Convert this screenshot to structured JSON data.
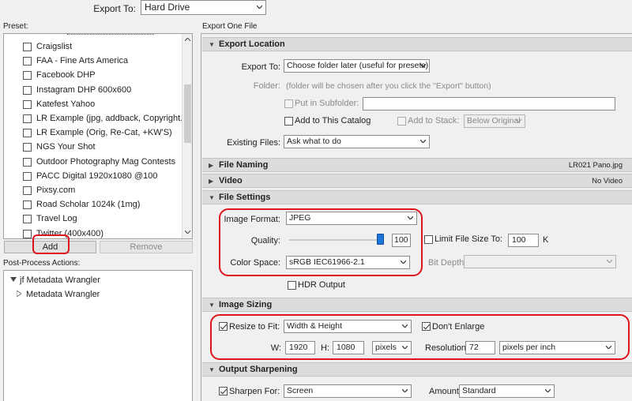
{
  "export_to": {
    "label": "Export To:",
    "value": "Hard Drive"
  },
  "preset_panel": {
    "label": "Preset:",
    "items": [
      "Craigslist",
      "FAA - Fine Arts America",
      "Facebook DHP",
      "Instagram DHP 600x600",
      "Katefest Yahoo",
      "LR Example (jpg, addback, Copyright...",
      "LR Example (Orig, Re-Cat, +KW'S)",
      "NGS Your Shot",
      "Outdoor Photography Mag Contests",
      "PACC Digital 1920x1080 @100",
      "Pixsy.com",
      "Road Scholar 1024k (1mg)",
      "Travel Log",
      "Twitter (400x400)"
    ],
    "add_label": "Add",
    "remove_label": "Remove"
  },
  "post_process": {
    "label": "Post-Process Actions:",
    "items": [
      {
        "name": "jf Metadata Wrangler",
        "expanded": true
      },
      {
        "name": "Metadata Wrangler",
        "expanded": false
      }
    ]
  },
  "right_panel_label": "Export One File",
  "export_location": {
    "title": "Export Location",
    "export_to_label": "Export To:",
    "export_to_value": "Choose folder later (useful for presets)",
    "folder_label": "Folder:",
    "folder_value": "(folder will be chosen after you click the \"Export\" button)",
    "subfolder_label": "Put in Subfolder:",
    "add_catalog_label": "Add to This Catalog",
    "add_stack_label": "Add to Stack:",
    "stack_value": "Below Original",
    "existing_label": "Existing Files:",
    "existing_value": "Ask what to do"
  },
  "file_naming": {
    "title": "File Naming",
    "summary": "LR021 Pano.jpg"
  },
  "video": {
    "title": "Video",
    "summary": "No Video"
  },
  "file_settings": {
    "title": "File Settings",
    "format_label": "Image Format:",
    "format_value": "JPEG",
    "quality_label": "Quality:",
    "quality_value": "100",
    "quality": 100,
    "limit_label": "Limit File Size To:",
    "limit_value": "100",
    "limit_unit": "K",
    "color_label": "Color Space:",
    "color_value": "sRGB IEC61966-2.1",
    "bit_depth_label": "Bit Depth:",
    "hdr_label": "HDR Output"
  },
  "image_sizing": {
    "title": "Image Sizing",
    "resize_label": "Resize to Fit:",
    "resize_value": "Width & Height",
    "dont_enlarge_label": "Don't Enlarge",
    "w_label": "W:",
    "w_value": "1920",
    "h_label": "H:",
    "h_value": "1080",
    "unit_value": "pixels",
    "res_label": "Resolution:",
    "res_value": "72",
    "res_unit_value": "pixels per inch"
  },
  "output_sharpening": {
    "title": "Output Sharpening",
    "sharpen_label": "Sharpen For:",
    "sharpen_value": "Screen",
    "amount_label": "Amount:",
    "amount_value": "Standard"
  },
  "colors": {
    "highlight": "#e0151b",
    "slider_thumb": "#1b74d8"
  }
}
